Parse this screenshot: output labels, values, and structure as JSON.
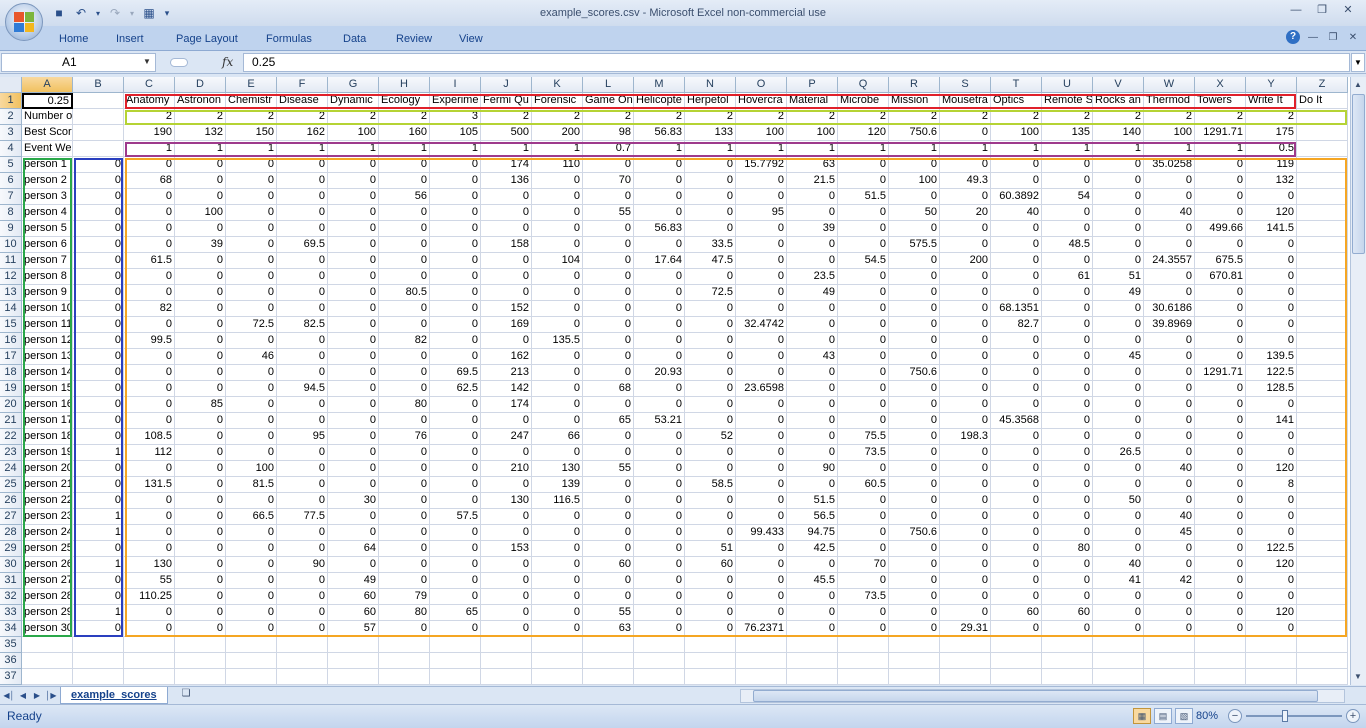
{
  "window": {
    "title": "example_scores.csv - Microsoft Excel non-commercial use"
  },
  "ribbon": {
    "tabs": [
      "Home",
      "Insert",
      "Page Layout",
      "Formulas",
      "Data",
      "Review",
      "View"
    ]
  },
  "namebox": "A1",
  "formula": "0.25",
  "columns": [
    "A",
    "B",
    "C",
    "D",
    "E",
    "F",
    "G",
    "H",
    "I",
    "J",
    "K",
    "L",
    "M",
    "N",
    "O",
    "P",
    "Q",
    "R",
    "S",
    "T",
    "U",
    "V",
    "W",
    "X",
    "Y",
    "Z"
  ],
  "row_numbers": [
    1,
    2,
    3,
    4,
    5,
    6,
    7,
    8,
    9,
    10,
    11,
    12,
    13,
    14,
    15,
    16,
    17,
    18,
    19,
    20,
    21,
    22,
    23,
    24,
    25,
    26,
    27,
    28,
    29,
    30,
    31,
    32,
    33,
    34,
    35,
    36,
    37
  ],
  "rows": [
    {
      "a": "0.25",
      "b": "",
      "vals": [
        "Anatomy",
        "Astronon",
        "Chemistr",
        "Disease",
        "Dynamic",
        "Ecology",
        "Experime",
        "Fermi Qu",
        "Forensic",
        "Game On",
        "Helicopte",
        "Herpetol",
        "Hovercra",
        "Material",
        "Microbe",
        "Mission",
        "Mousetra",
        "Optics",
        "Remote S",
        "Rocks an",
        "Thermod",
        "Towers",
        "Write It",
        "Do It"
      ]
    },
    {
      "a": "Number of people",
      "b": "",
      "vals": [
        "2",
        "2",
        "2",
        "2",
        "2",
        "2",
        "3",
        "2",
        "2",
        "2",
        "2",
        "2",
        "2",
        "2",
        "2",
        "2",
        "2",
        "2",
        "2",
        "2",
        "2",
        "2",
        "2",
        ""
      ]
    },
    {
      "a": "Best Score Possible",
      "b": "",
      "vals": [
        "190",
        "132",
        "150",
        "162",
        "100",
        "160",
        "105",
        "500",
        "200",
        "98",
        "56.83",
        "133",
        "100",
        "100",
        "120",
        "750.6",
        "0",
        "100",
        "135",
        "140",
        "100",
        "1291.71",
        "175",
        ""
      ]
    },
    {
      "a": "Event Weight senior",
      "b": "",
      "vals": [
        "1",
        "1",
        "1",
        "1",
        "1",
        "1",
        "1",
        "1",
        "1",
        "0.7",
        "1",
        "1",
        "1",
        "1",
        "1",
        "1",
        "1",
        "1",
        "1",
        "1",
        "1",
        "1",
        "0.5",
        ""
      ]
    },
    {
      "a": "person 1",
      "b": "0",
      "vals": [
        "0",
        "0",
        "0",
        "0",
        "0",
        "0",
        "0",
        "174",
        "110",
        "0",
        "0",
        "0",
        "15.7792",
        "63",
        "0",
        "0",
        "0",
        "0",
        "0",
        "0",
        "35.0258",
        "0",
        "119",
        ""
      ]
    },
    {
      "a": "person 2",
      "b": "0",
      "vals": [
        "68",
        "0",
        "0",
        "0",
        "0",
        "0",
        "0",
        "136",
        "0",
        "70",
        "0",
        "0",
        "0",
        "21.5",
        "0",
        "100",
        "49.3",
        "0",
        "0",
        "0",
        "0",
        "0",
        "132",
        ""
      ]
    },
    {
      "a": "person 3",
      "b": "0",
      "vals": [
        "0",
        "0",
        "0",
        "0",
        "0",
        "56",
        "0",
        "0",
        "0",
        "0",
        "0",
        "0",
        "0",
        "0",
        "51.5",
        "0",
        "0",
        "60.3892",
        "54",
        "0",
        "0",
        "0",
        "0",
        ""
      ]
    },
    {
      "a": "person 4",
      "b": "0",
      "vals": [
        "0",
        "100",
        "0",
        "0",
        "0",
        "0",
        "0",
        "0",
        "0",
        "55",
        "0",
        "0",
        "95",
        "0",
        "0",
        "50",
        "20",
        "40",
        "0",
        "0",
        "40",
        "0",
        "120",
        ""
      ]
    },
    {
      "a": "person 5",
      "b": "0",
      "vals": [
        "0",
        "0",
        "0",
        "0",
        "0",
        "0",
        "0",
        "0",
        "0",
        "0",
        "56.83",
        "0",
        "0",
        "39",
        "0",
        "0",
        "0",
        "0",
        "0",
        "0",
        "0",
        "499.66",
        "141.5",
        ""
      ]
    },
    {
      "a": "person 6",
      "b": "0",
      "vals": [
        "0",
        "39",
        "0",
        "69.5",
        "0",
        "0",
        "0",
        "158",
        "0",
        "0",
        "0",
        "33.5",
        "0",
        "0",
        "0",
        "575.5",
        "0",
        "0",
        "48.5",
        "0",
        "0",
        "0",
        "0",
        ""
      ]
    },
    {
      "a": "person 7",
      "b": "0",
      "vals": [
        "61.5",
        "0",
        "0",
        "0",
        "0",
        "0",
        "0",
        "0",
        "104",
        "0",
        "17.64",
        "47.5",
        "0",
        "0",
        "54.5",
        "0",
        "200",
        "0",
        "0",
        "0",
        "24.3557",
        "675.5",
        "0",
        ""
      ]
    },
    {
      "a": "person 8",
      "b": "0",
      "vals": [
        "0",
        "0",
        "0",
        "0",
        "0",
        "0",
        "0",
        "0",
        "0",
        "0",
        "0",
        "0",
        "0",
        "23.5",
        "0",
        "0",
        "0",
        "0",
        "61",
        "51",
        "0",
        "670.81",
        "0",
        ""
      ]
    },
    {
      "a": "person 9",
      "b": "0",
      "vals": [
        "0",
        "0",
        "0",
        "0",
        "0",
        "80.5",
        "0",
        "0",
        "0",
        "0",
        "0",
        "72.5",
        "0",
        "49",
        "0",
        "0",
        "0",
        "0",
        "0",
        "49",
        "0",
        "0",
        "0",
        ""
      ]
    },
    {
      "a": "person 10",
      "b": "0",
      "vals": [
        "82",
        "0",
        "0",
        "0",
        "0",
        "0",
        "0",
        "152",
        "0",
        "0",
        "0",
        "0",
        "0",
        "0",
        "0",
        "0",
        "0",
        "68.1351",
        "0",
        "0",
        "30.6186",
        "0",
        "0",
        ""
      ]
    },
    {
      "a": "person 11",
      "b": "0",
      "vals": [
        "0",
        "0",
        "72.5",
        "82.5",
        "0",
        "0",
        "0",
        "169",
        "0",
        "0",
        "0",
        "0",
        "32.4742",
        "0",
        "0",
        "0",
        "0",
        "82.7",
        "0",
        "0",
        "39.8969",
        "0",
        "0",
        ""
      ]
    },
    {
      "a": "person 12",
      "b": "0",
      "vals": [
        "99.5",
        "0",
        "0",
        "0",
        "0",
        "82",
        "0",
        "0",
        "135.5",
        "0",
        "0",
        "0",
        "0",
        "0",
        "0",
        "0",
        "0",
        "0",
        "0",
        "0",
        "0",
        "0",
        "0",
        ""
      ]
    },
    {
      "a": "person 13",
      "b": "0",
      "vals": [
        "0",
        "0",
        "46",
        "0",
        "0",
        "0",
        "0",
        "162",
        "0",
        "0",
        "0",
        "0",
        "0",
        "43",
        "0",
        "0",
        "0",
        "0",
        "0",
        "45",
        "0",
        "0",
        "139.5",
        ""
      ]
    },
    {
      "a": "person 14",
      "b": "0",
      "vals": [
        "0",
        "0",
        "0",
        "0",
        "0",
        "0",
        "69.5",
        "213",
        "0",
        "0",
        "20.93",
        "0",
        "0",
        "0",
        "0",
        "750.6",
        "0",
        "0",
        "0",
        "0",
        "0",
        "1291.71",
        "122.5",
        ""
      ]
    },
    {
      "a": "person 15",
      "b": "0",
      "vals": [
        "0",
        "0",
        "0",
        "94.5",
        "0",
        "0",
        "62.5",
        "142",
        "0",
        "68",
        "0",
        "0",
        "23.6598",
        "0",
        "0",
        "0",
        "0",
        "0",
        "0",
        "0",
        "0",
        "0",
        "128.5",
        ""
      ]
    },
    {
      "a": "person 16",
      "b": "0",
      "vals": [
        "0",
        "85",
        "0",
        "0",
        "0",
        "80",
        "0",
        "174",
        "0",
        "0",
        "0",
        "0",
        "0",
        "0",
        "0",
        "0",
        "0",
        "0",
        "0",
        "0",
        "0",
        "0",
        "0",
        ""
      ]
    },
    {
      "a": "person 17",
      "b": "0",
      "vals": [
        "0",
        "0",
        "0",
        "0",
        "0",
        "0",
        "0",
        "0",
        "0",
        "65",
        "53.21",
        "0",
        "0",
        "0",
        "0",
        "0",
        "0",
        "45.3568",
        "0",
        "0",
        "0",
        "0",
        "141",
        ""
      ]
    },
    {
      "a": "person 18",
      "b": "0",
      "vals": [
        "108.5",
        "0",
        "0",
        "95",
        "0",
        "76",
        "0",
        "247",
        "66",
        "0",
        "0",
        "52",
        "0",
        "0",
        "75.5",
        "0",
        "198.3",
        "0",
        "0",
        "0",
        "0",
        "0",
        "0",
        ""
      ]
    },
    {
      "a": "person 19",
      "b": "1",
      "vals": [
        "112",
        "0",
        "0",
        "0",
        "0",
        "0",
        "0",
        "0",
        "0",
        "0",
        "0",
        "0",
        "0",
        "0",
        "73.5",
        "0",
        "0",
        "0",
        "0",
        "26.5",
        "0",
        "0",
        "0",
        ""
      ]
    },
    {
      "a": "person 20",
      "b": "0",
      "vals": [
        "0",
        "0",
        "100",
        "0",
        "0",
        "0",
        "0",
        "210",
        "130",
        "55",
        "0",
        "0",
        "0",
        "90",
        "0",
        "0",
        "0",
        "0",
        "0",
        "0",
        "40",
        "0",
        "120",
        ""
      ]
    },
    {
      "a": "person 21",
      "b": "0",
      "vals": [
        "131.5",
        "0",
        "81.5",
        "0",
        "0",
        "0",
        "0",
        "0",
        "139",
        "0",
        "0",
        "58.5",
        "0",
        "0",
        "60.5",
        "0",
        "0",
        "0",
        "0",
        "0",
        "0",
        "0",
        "8",
        ""
      ]
    },
    {
      "a": "person 22",
      "b": "0",
      "vals": [
        "0",
        "0",
        "0",
        "0",
        "30",
        "0",
        "0",
        "130",
        "116.5",
        "0",
        "0",
        "0",
        "0",
        "51.5",
        "0",
        "0",
        "0",
        "0",
        "0",
        "50",
        "0",
        "0",
        "0",
        ""
      ]
    },
    {
      "a": "person 23",
      "b": "1",
      "vals": [
        "0",
        "0",
        "66.5",
        "77.5",
        "0",
        "0",
        "57.5",
        "0",
        "0",
        "0",
        "0",
        "0",
        "0",
        "56.5",
        "0",
        "0",
        "0",
        "0",
        "0",
        "0",
        "40",
        "0",
        "0",
        ""
      ]
    },
    {
      "a": "person 24",
      "b": "1",
      "vals": [
        "0",
        "0",
        "0",
        "0",
        "0",
        "0",
        "0",
        "0",
        "0",
        "0",
        "0",
        "0",
        "99.433",
        "94.75",
        "0",
        "750.6",
        "0",
        "0",
        "0",
        "0",
        "45",
        "0",
        "0",
        ""
      ]
    },
    {
      "a": "person 25",
      "b": "0",
      "vals": [
        "0",
        "0",
        "0",
        "0",
        "64",
        "0",
        "0",
        "153",
        "0",
        "0",
        "0",
        "51",
        "0",
        "42.5",
        "0",
        "0",
        "0",
        "0",
        "80",
        "0",
        "0",
        "0",
        "122.5",
        ""
      ]
    },
    {
      "a": "person 26",
      "b": "1",
      "vals": [
        "130",
        "0",
        "0",
        "90",
        "0",
        "0",
        "0",
        "0",
        "0",
        "60",
        "0",
        "60",
        "0",
        "0",
        "70",
        "0",
        "0",
        "0",
        "0",
        "40",
        "0",
        "0",
        "120",
        ""
      ]
    },
    {
      "a": "person 27",
      "b": "0",
      "vals": [
        "55",
        "0",
        "0",
        "0",
        "49",
        "0",
        "0",
        "0",
        "0",
        "0",
        "0",
        "0",
        "0",
        "45.5",
        "0",
        "0",
        "0",
        "0",
        "0",
        "41",
        "42",
        "0",
        "0",
        ""
      ]
    },
    {
      "a": "person 28",
      "b": "0",
      "vals": [
        "110.25",
        "0",
        "0",
        "0",
        "60",
        "79",
        "0",
        "0",
        "0",
        "0",
        "0",
        "0",
        "0",
        "0",
        "73.5",
        "0",
        "0",
        "0",
        "0",
        "0",
        "0",
        "0",
        "0",
        ""
      ]
    },
    {
      "a": "person 29",
      "b": "1",
      "vals": [
        "0",
        "0",
        "0",
        "0",
        "60",
        "80",
        "65",
        "0",
        "0",
        "55",
        "0",
        "0",
        "0",
        "0",
        "0",
        "0",
        "0",
        "60",
        "60",
        "0",
        "0",
        "0",
        "120",
        ""
      ]
    },
    {
      "a": "person 30",
      "b": "0",
      "vals": [
        "0",
        "0",
        "0",
        "0",
        "57",
        "0",
        "0",
        "0",
        "0",
        "63",
        "0",
        "0",
        "76.2371",
        "0",
        "0",
        "0",
        "29.31",
        "0",
        "0",
        "0",
        "0",
        "0",
        "0",
        ""
      ]
    }
  ],
  "sheet_tab": "example_scores",
  "status": "Ready",
  "zoom": "80%",
  "highlight_colors": {
    "red": "#e0202a",
    "lime": "#b5d334",
    "purple": "#9e3a8c",
    "green": "#2aa84a",
    "blue": "#2a3fbf",
    "orange": "#f5a623"
  }
}
